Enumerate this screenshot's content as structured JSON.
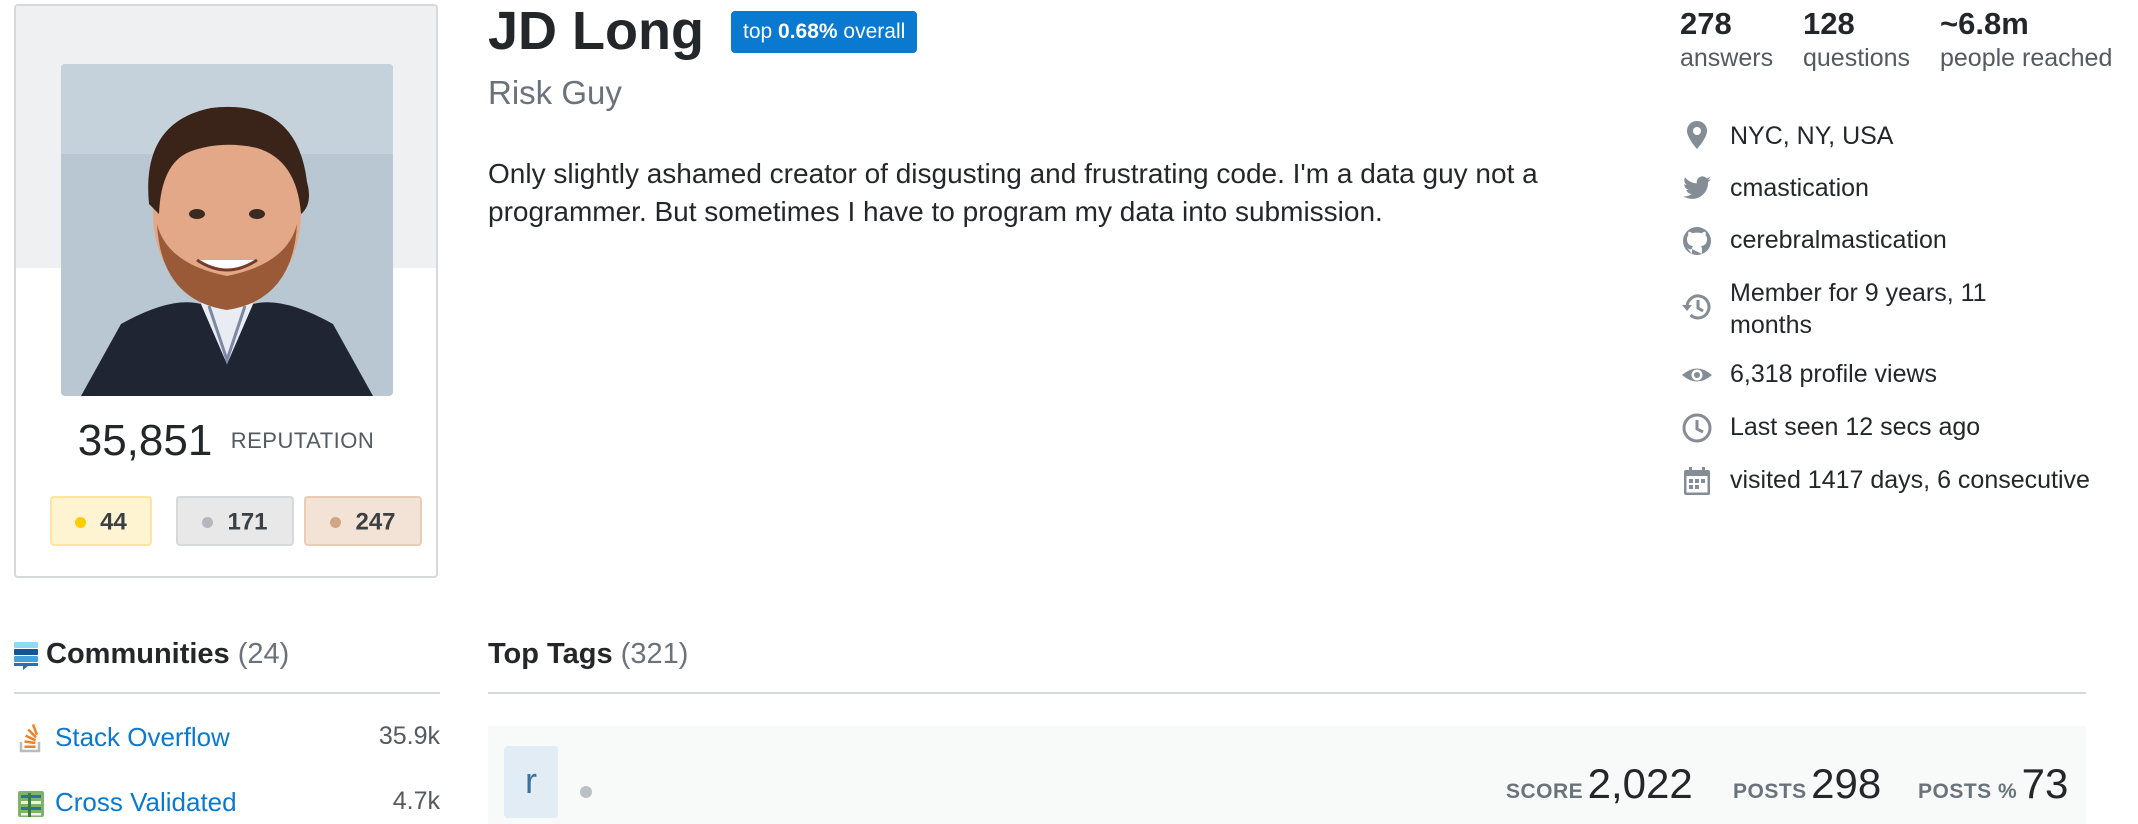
{
  "profile": {
    "name": "JD Long",
    "rank_badge": {
      "prefix": "top ",
      "value": "0.68%",
      "suffix": " overall"
    },
    "title": "Risk Guy",
    "bio": "Only slightly ashamed creator of disgusting and frustrating code. I'm a data guy not a programmer. But sometimes I have to program my data into submission.",
    "reputation": {
      "value": "35,851",
      "label": "REPUTATION"
    },
    "badges": [
      {
        "type": "gold",
        "count": "44",
        "bg": "#fff4d1",
        "border": "#ffe49e",
        "dot": "#ffcc01"
      },
      {
        "type": "silver",
        "count": "171",
        "bg": "#e8e8e8",
        "border": "#d6d9dc",
        "dot": "#b4b8bc"
      },
      {
        "type": "bronze",
        "count": "247",
        "bg": "#f2e3d6",
        "border": "#e8cdb4",
        "dot": "#d1a684"
      }
    ]
  },
  "stats": [
    {
      "value": "278",
      "label": "answers"
    },
    {
      "value": "128",
      "label": "questions"
    },
    {
      "value": "~6.8m",
      "label": "people reached"
    }
  ],
  "info": [
    {
      "icon": "location-pin-icon",
      "text": "NYC, NY, USA"
    },
    {
      "icon": "twitter-icon",
      "text": "cmastication"
    },
    {
      "icon": "github-icon",
      "text": "cerebralmastication"
    },
    {
      "icon": "history-icon",
      "text_line1": "Member for 9 years, 11",
      "text_line2": "months"
    },
    {
      "icon": "eye-icon",
      "text": "6,318 profile views"
    },
    {
      "icon": "clock-icon",
      "text": "Last seen 12 secs ago"
    },
    {
      "icon": "calendar-icon",
      "text": "visited 1417 days, 6 consecutive"
    }
  ],
  "communities": {
    "title": "Communities",
    "count": "(24)",
    "items": [
      {
        "name": "Stack Overflow",
        "score": "35.9k",
        "icon": "stack-overflow-icon"
      },
      {
        "name": "Cross Validated",
        "score": "4.7k",
        "icon": "cross-validated-icon"
      }
    ]
  },
  "top_tags": {
    "title": "Top Tags",
    "count": "(321)",
    "rows": [
      {
        "tag": "r",
        "score_label": "SCORE",
        "score": "2,022",
        "posts_label": "POSTS",
        "posts": "298",
        "posts_pct_label": "POSTS %",
        "posts_pct": "73"
      }
    ]
  },
  "colors": {
    "link_blue": "#0a79d0",
    "rank_badge_bg": "#0a79d0",
    "icon_gray": "#848d95"
  }
}
